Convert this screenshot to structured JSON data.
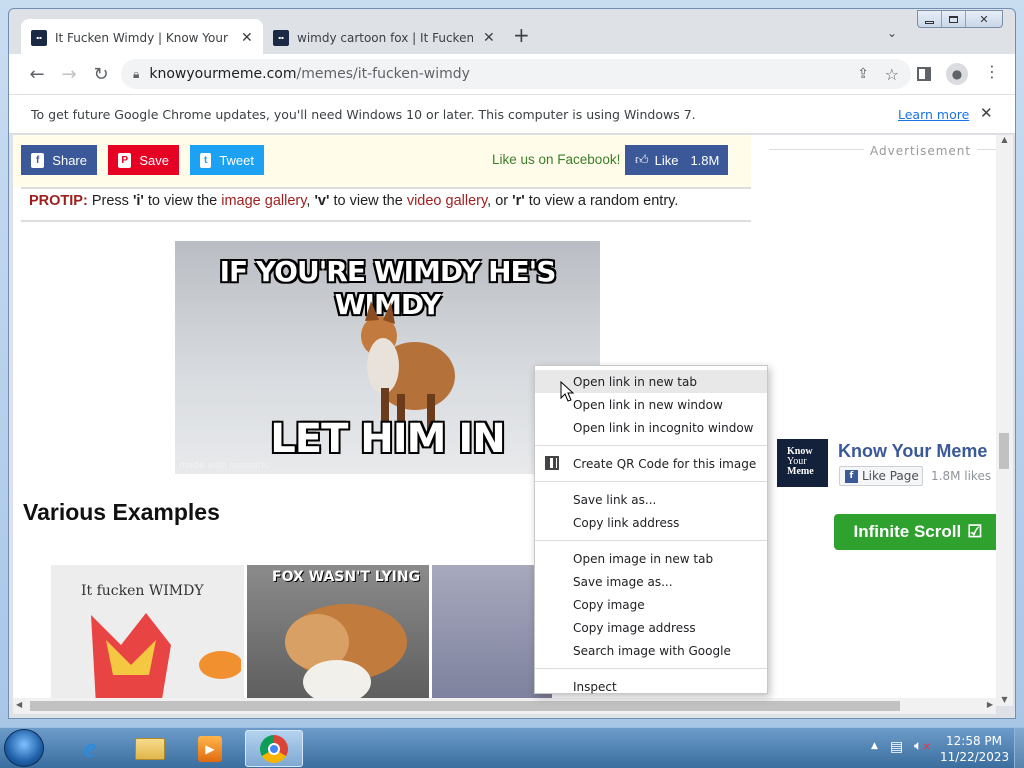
{
  "browser": {
    "tabs": [
      {
        "title": "It Fucken Wimdy | Know Your Me",
        "active": true
      },
      {
        "title": "wimdy cartoon fox | It Fucken Wi",
        "active": false
      }
    ],
    "new_tab": "+",
    "url_host": "knowyourmeme.com",
    "url_path": "/memes/it-fucken-wimdy"
  },
  "infobar": {
    "message": "To get future Google Chrome updates, you'll need Windows 10 or later. This computer is using Windows 7.",
    "link": "Learn more"
  },
  "social": {
    "share": "Share",
    "save": "Save",
    "tweet": "Tweet",
    "like_text": "Like us on Facebook!",
    "like": "Like",
    "like_count": "1.8M"
  },
  "protip": {
    "label": "PROTIP:",
    "p1": " Press ",
    "k1": "'i'",
    "p2": " to view the ",
    "l1": "image gallery",
    "p3": ", ",
    "k2": "'v'",
    "p4": " to view the ",
    "l2": "video gallery",
    "p5": ", or ",
    "k3": "'r'",
    "p6": " to view a random entry."
  },
  "meme": {
    "top_text": "IF YOU'RE WIMDY HE'S WIMDY",
    "bottom_text": "LET HIM IN",
    "watermark": "made with mematic"
  },
  "section": {
    "heading": "Various Examples",
    "thumb1_text": "It fucken WIMDY",
    "thumb2_text": "FOX WASN'T LYING"
  },
  "sidebar": {
    "advert": "Advertisement",
    "kym_logo": [
      "Know",
      "Your",
      "Meme"
    ],
    "kym_name": "Know Your Meme",
    "fb_like_page": "Like Page",
    "fb_likes": "1.8M likes",
    "infinite_scroll": "Infinite Scroll"
  },
  "context_menu": {
    "groups": [
      [
        "Open link in new tab",
        "Open link in new window",
        "Open link in incognito window"
      ],
      [
        "Create QR Code for this image"
      ],
      [
        "Save link as...",
        "Copy link address"
      ],
      [
        "Open image in new tab",
        "Save image as...",
        "Copy image",
        "Copy image address",
        "Search image with Google"
      ],
      [
        "Inspect"
      ]
    ]
  },
  "taskbar": {
    "time": "12:58 PM",
    "date": "11/22/2023"
  },
  "colors": {
    "facebook": "#3b5998",
    "pinterest": "#e60023",
    "twitter": "#1da1f2",
    "protip_red": "#9e1d1d",
    "link_red": "#9e1d1d",
    "infinite_green": "#2ea12e"
  }
}
